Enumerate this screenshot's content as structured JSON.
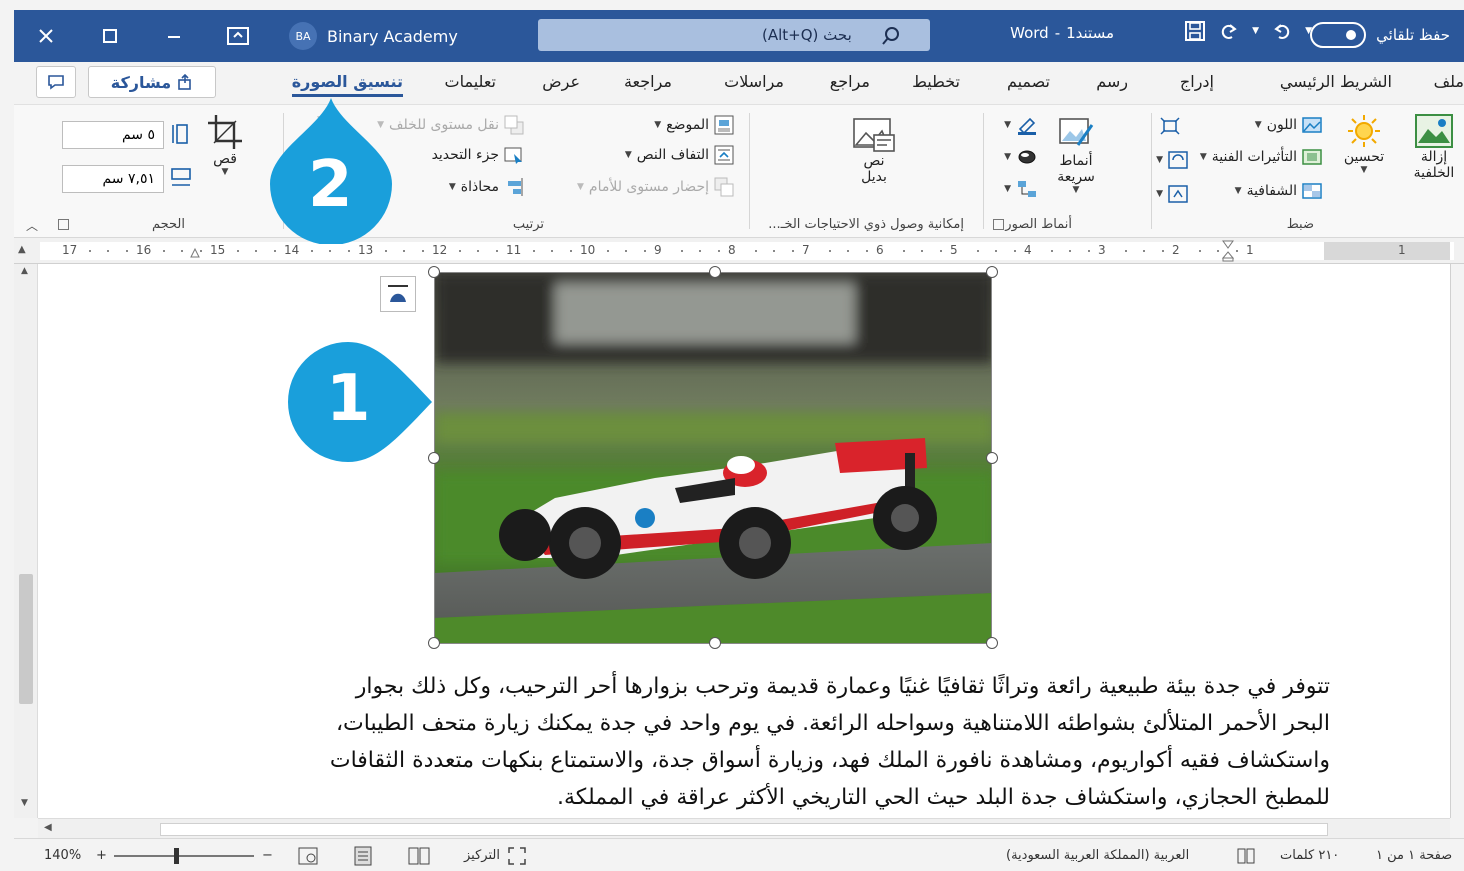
{
  "app": "Word",
  "titlebar": {
    "autosave_label": "حفظ تلقائي",
    "doc_title": "مستند1",
    "app_name": "Word",
    "title_sep": "-",
    "search_placeholder": "بحث (Alt+Q)",
    "user_initials": "BA",
    "user_name": "Binary Academy"
  },
  "tabs": [
    {
      "label": "ملف"
    },
    {
      "label": "الشريط الرئيسي"
    },
    {
      "label": "إدراج"
    },
    {
      "label": "رسم"
    },
    {
      "label": "تصميم"
    },
    {
      "label": "تخطيط"
    },
    {
      "label": "مراجع"
    },
    {
      "label": "مراسلات"
    },
    {
      "label": "مراجعة"
    },
    {
      "label": "عرض"
    },
    {
      "label": "تعليمات"
    },
    {
      "label": "تنسيق الصورة",
      "active": true
    }
  ],
  "share_label": "مشاركة",
  "ribbon": {
    "adjust": {
      "label": "ضبط",
      "remove_bg": "إزالة الخلفية",
      "corrections": "تحسين",
      "color": "اللون",
      "artistic": "التأثيرات الفنية",
      "transparency": "الشفافية"
    },
    "styles": {
      "label": "أنماط الصور",
      "quick_styles": "أنماط سريعة"
    },
    "accessibility": {
      "label": "إمكانية وصول ذوي الاحتياجات الخـ...",
      "alt_text": "نص بديل"
    },
    "arrange": {
      "label": "ترتيب",
      "position": "الموضع",
      "wrap_text": "التفاف النص",
      "bring_forward": "إحضار مستوى للأمام",
      "send_backward": "نقل مستوى للخلف",
      "selection_pane": "جزء التحديد",
      "align": "محاذاة"
    },
    "size": {
      "label": "الحجم",
      "crop": "قص",
      "height": "٥ سم",
      "width": "٧,٥١ سم"
    }
  },
  "ruler_numbers": [
    "17",
    "16",
    "15",
    "14",
    "13",
    "12",
    "11",
    "10",
    "9",
    "8",
    "7",
    "6",
    "5",
    "4",
    "3",
    "2",
    "1",
    "1"
  ],
  "callouts": [
    {
      "number": "1",
      "target": "picture"
    },
    {
      "number": "2",
      "target": "tab-picture-format"
    }
  ],
  "document": {
    "lines": [
      "تتوفر في جدة بيئة طبيعية رائعة وتراثًا ثقافيًا غنيًا وعمارة قديمة وترحب بزوارها أحر الترحيب، وكل ذلك بجوار",
      "البحر الأحمر المتلألئ بشواطئه اللامتناهية وسواحله الرائعة. في يوم واحد في جدة يمكنك زيارة متحف الطيبات،",
      "واستكشاف فقيه أكواريوم، ومشاهدة نافورة الملك فهد، وزيارة أسواق جدة، والاستمتاع بنكهات متعددة الثقافات",
      "للمطبخ الحجازي، واستكشاف جدة البلد حيث الحي التاريخي الأكثر عراقة في المملكة."
    ]
  },
  "statusbar": {
    "page": "صفحة ١ من ١",
    "words": "٢١٠ كلمات",
    "language": "العربية (المملكة العربية السعودية)",
    "focus": "التركيز",
    "zoom": "140%"
  },
  "colors": {
    "titlebar": "#2b579a",
    "callout": "#1a9fdb",
    "accent": "#2b579a"
  }
}
